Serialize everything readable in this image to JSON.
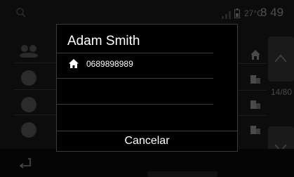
{
  "status_bar": {
    "temperature": "27°C",
    "time": "8 49"
  },
  "side_panel": {
    "page_counter": "14/80"
  },
  "modal": {
    "contact_name": "Adam Smith",
    "phone_type_icon": "home-icon",
    "phone_number": "0689898989",
    "cancel_label": "Cancelar"
  },
  "colors": {
    "background": "#000000",
    "dim_text": "#4f4f4f",
    "modal_border": "#3b3b3b",
    "modal_text": "#ffffff"
  }
}
